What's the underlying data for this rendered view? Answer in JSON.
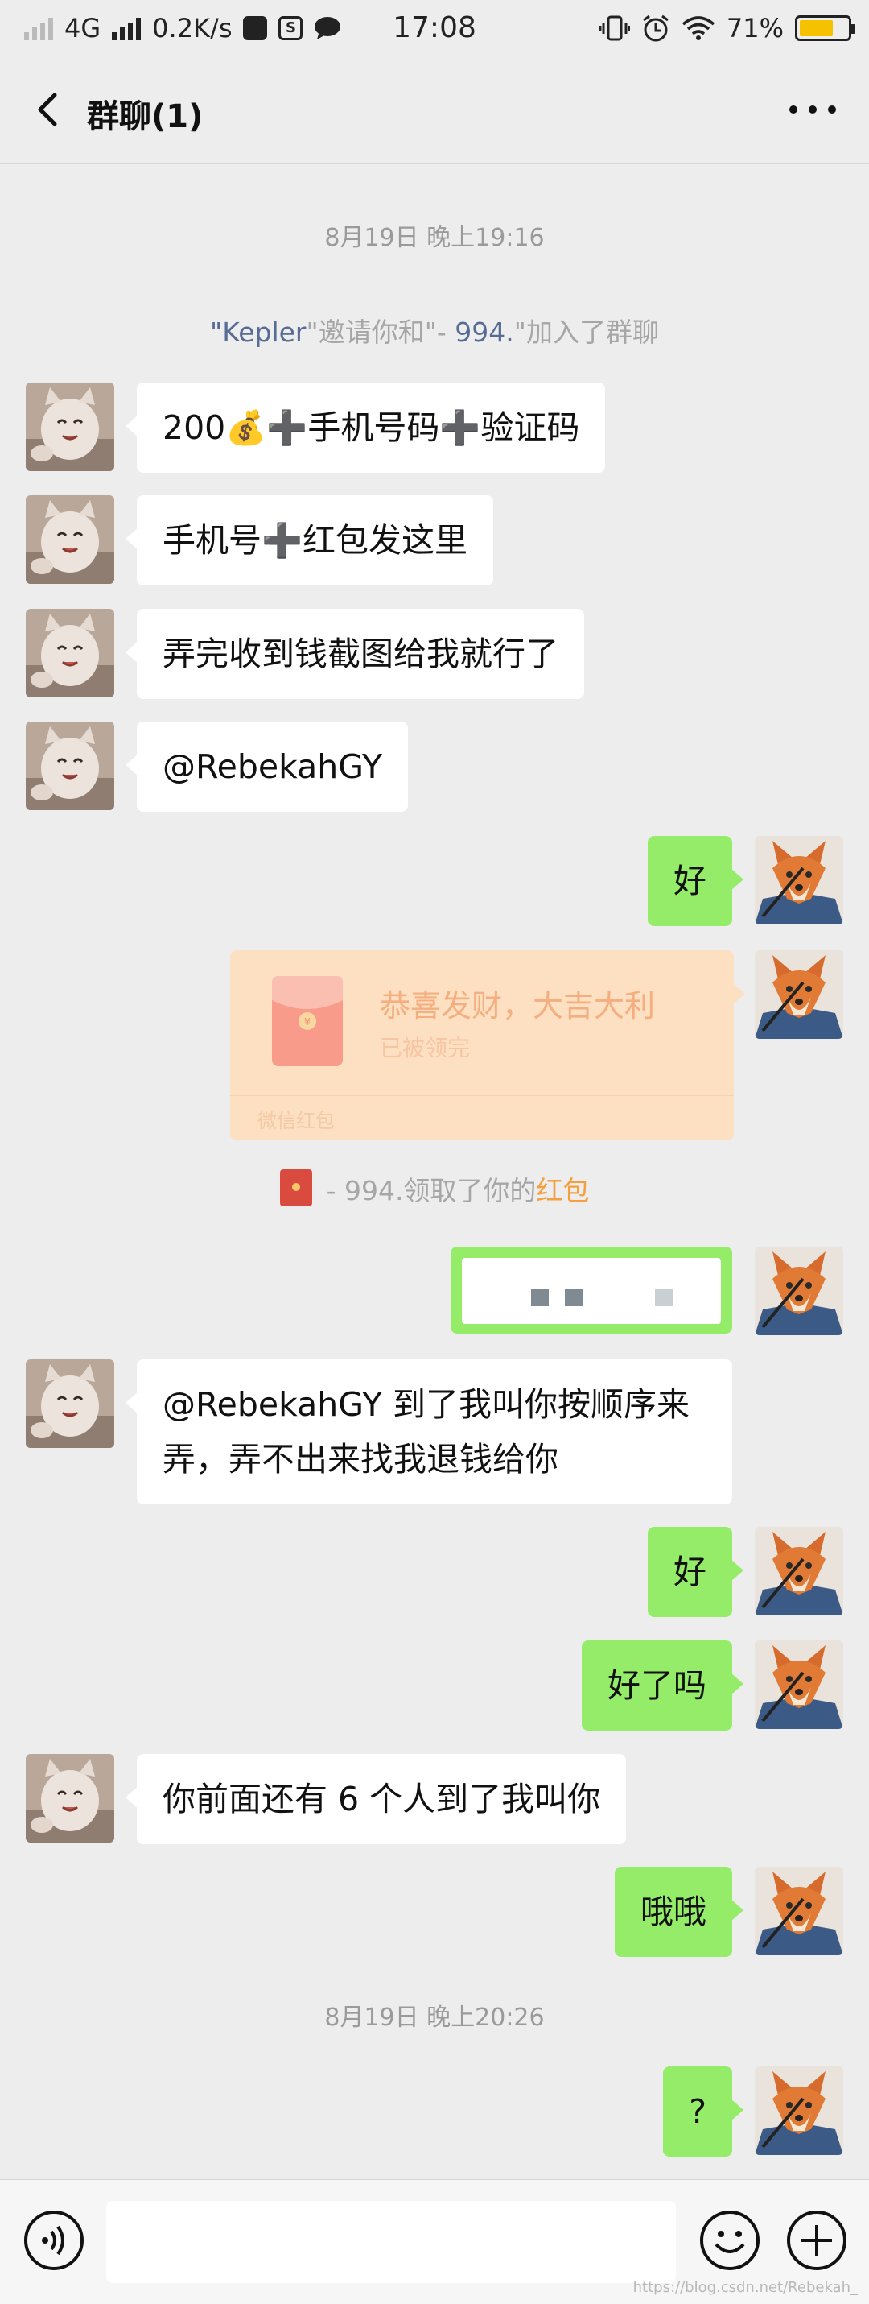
{
  "status_bar": {
    "network": "4G",
    "speed": "0.2K/s",
    "time": "17:08",
    "battery": "71%",
    "battery_level": 0.71,
    "icons": [
      "signal-icon",
      "message-icon",
      "s-app-icon",
      "chat-icon",
      "vibrate-icon",
      "alarm-icon",
      "wifi-icon",
      "battery-icon"
    ]
  },
  "header": {
    "back_icon": "chevron-left-icon",
    "title": "群聊(1)",
    "more_icon": "more-dots-icon"
  },
  "chat": {
    "timestamp_1": "8月19日 晚上19:16",
    "invite": {
      "q1": "\"",
      "inviter": "Kepler",
      "mid": "\"邀请你和\"- ",
      "invitee": "994.",
      "end": "\"加入了群聊"
    },
    "messages": [
      {
        "side": "left",
        "text": "200💰➕手机号码➕验证码"
      },
      {
        "side": "left",
        "text": "手机号➕红包发这里"
      },
      {
        "side": "left",
        "text": "弄完收到钱截图给我就行了"
      },
      {
        "side": "left",
        "text": "@RebekahGY"
      },
      {
        "side": "right",
        "text": "好"
      },
      {
        "side": "left",
        "text": "@RebekahGY 到了我叫你按顺序来弄，弄不出来找我退钱给你"
      },
      {
        "side": "right",
        "text": "好"
      },
      {
        "side": "right",
        "text": "好了吗"
      },
      {
        "side": "left",
        "text": "你前面还有 6 个人到了我叫你"
      },
      {
        "side": "right",
        "text": "哦哦"
      },
      {
        "side": "right",
        "text": "?"
      }
    ],
    "red_packet": {
      "title": "恭喜发财，大吉大利",
      "status": "已被领完",
      "footer": "微信红包"
    },
    "packet_notice": {
      "who": "-   994.领取了你的",
      "link": "红包"
    },
    "timestamp_2": "8月19日 晚上20:26"
  },
  "input_bar": {
    "voice_icon": "voice-icon",
    "emoji_icon": "emoji-icon",
    "plus_icon": "plus-circle-icon",
    "value": ""
  },
  "watermark": "https://blog.csdn.net/Rebekah_"
}
